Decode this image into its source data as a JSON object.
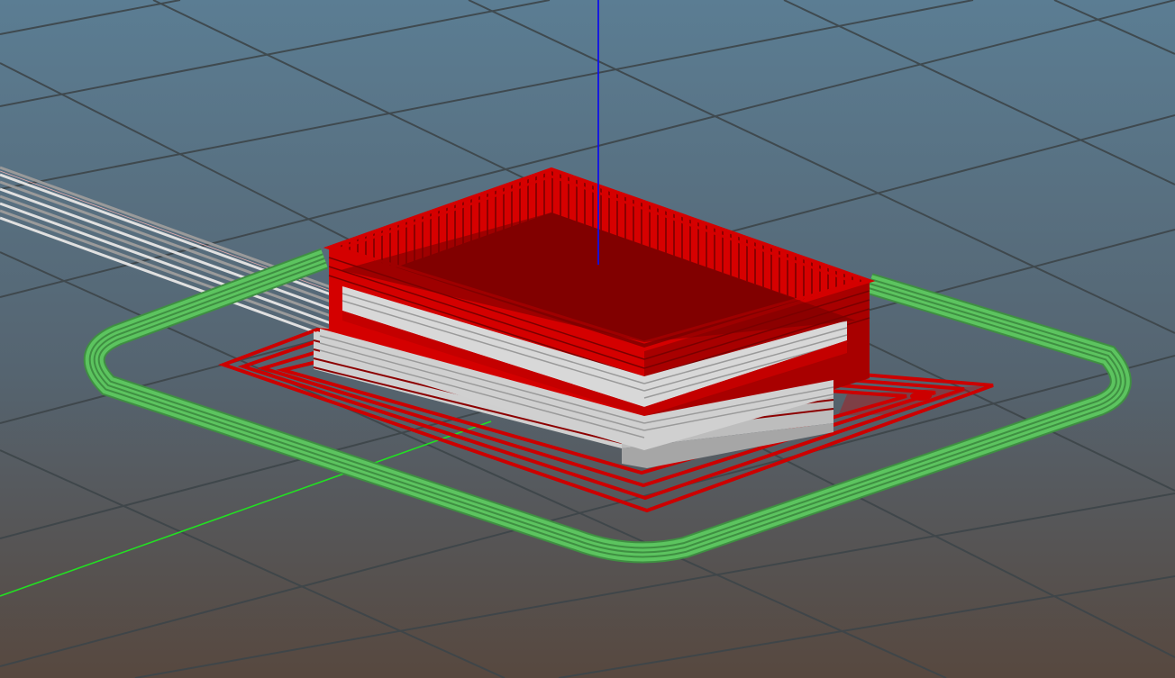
{
  "viewport": {
    "kind": "gcode-preview-3d",
    "background": {
      "top": "#5b7d93",
      "bottom": "#57483f"
    },
    "grid_color": "#3d4549"
  },
  "axes": {
    "z": "#1010e6",
    "y": "#22e022"
  },
  "toolpaths": {
    "skirt": {
      "color": "#5cc45f",
      "edge": "#3f8f42",
      "loops": 4
    },
    "brim": {
      "color": "#cc0000",
      "loops": 4
    },
    "walls": {
      "color": "#d40000",
      "dark": "#8c0000"
    },
    "travel_moves": {
      "color": "#d8d8d8",
      "dark": "#9a9a9a"
    }
  }
}
